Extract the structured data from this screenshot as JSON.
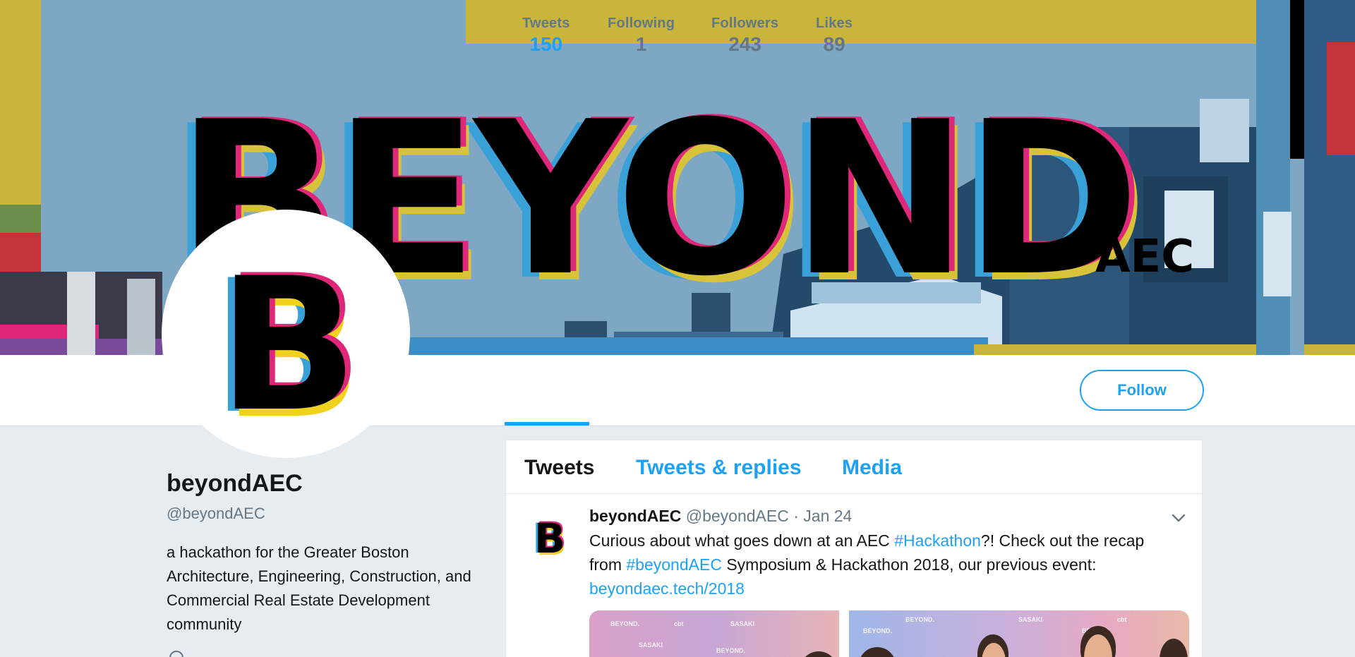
{
  "banner": {
    "title_text": "BEYOND",
    "subtitle_text": "AEC"
  },
  "avatar": {
    "letter": "B"
  },
  "stats": [
    {
      "label": "Tweets",
      "value": "150",
      "active": true
    },
    {
      "label": "Following",
      "value": "1",
      "active": false
    },
    {
      "label": "Followers",
      "value": "243",
      "active": false
    },
    {
      "label": "Likes",
      "value": "89",
      "active": false
    }
  ],
  "follow_button": {
    "label": "Follow"
  },
  "profile": {
    "name": "beyondAEC",
    "handle": "@beyondAEC",
    "bio": "a hackathon for the Greater Boston Architecture, Engineering, Construction, and Commercial Real Estate Development community"
  },
  "timeline": {
    "tabs": [
      {
        "label": "Tweets",
        "active": true
      },
      {
        "label": "Tweets & replies",
        "active": false
      },
      {
        "label": "Media",
        "active": false
      }
    ],
    "tweet": {
      "author_name": "beyondAEC",
      "author_handle": "@beyondAEC",
      "separator": "·",
      "date": "Jan 24",
      "text_part1": "Curious about what goes down at an AEC ",
      "hashtag1": "#Hackathon",
      "text_part2": "?! Check out the recap from ",
      "hashtag2": "#beyondAEC",
      "text_part3": " Symposium & Hackathon 2018, our previous event: ",
      "link": "beyondaec.tech/2018",
      "media_backdrop_words": [
        "BEYOND.",
        "cbt",
        "SASAKI"
      ]
    }
  },
  "colors": {
    "accent": "#1da1f2",
    "muted_text": "#657786",
    "banner_blue": "#7ea7c4",
    "banner_yellow": "#c9b53a",
    "glitch_pink": "#e0287a",
    "glitch_cyan": "#3aa0d8",
    "glitch_red": "#e23a3a"
  },
  "icons": {
    "caret": "chevron-down-icon",
    "location": "location-pin-icon"
  }
}
